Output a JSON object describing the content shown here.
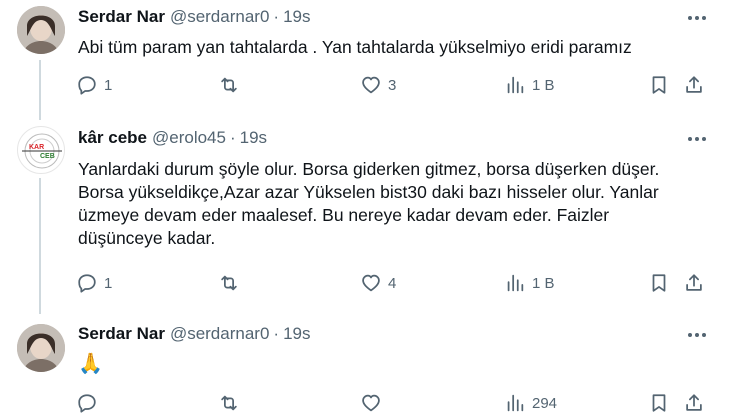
{
  "tweets": [
    {
      "author": "Serdar Nar",
      "handle": "@serdarnar0",
      "dot": "·",
      "time": "19s",
      "text": "Abi tüm param yan tahtalarda . Yan tahtalarda yükselmiyo eridi paramız",
      "replies": "1",
      "retweets": "",
      "likes": "3",
      "views": "1 B",
      "avatar_icon": "person-photo"
    },
    {
      "author": "kâr cebe",
      "handle": "@erolo45",
      "dot": "·",
      "time": "19s",
      "text_lines": [
        "Yanlardaki durum şöyle olur. Borsa giderken gitmez, borsa düşerken düşer.",
        "Borsa yükseldikçe,Azar azar Yükselen bist30 daki bazı hisseler olur. Yanlar",
        "üzmeye devam eder maalesef. Bu nereye kadar devam eder. Faizler",
        "düşünceye kadar."
      ],
      "replies": "1",
      "retweets": "",
      "likes": "4",
      "views": "1 B",
      "avatar_icon": "logo",
      "logo_text_top": "KAR",
      "logo_text_bottom": "CEB"
    },
    {
      "author": "Serdar Nar",
      "handle": "@serdarnar0",
      "dot": "·",
      "time": "19s",
      "text": "🙏",
      "replies": "",
      "retweets": "",
      "likes": "",
      "views": "294",
      "avatar_icon": "person-photo"
    }
  ],
  "colors": {
    "text": "#0f1419",
    "secondary": "#536471",
    "thread_line": "#cfd9de",
    "logo_red": "#d9252a",
    "logo_green": "#2e7d32"
  },
  "icons": [
    "reply-icon",
    "retweet-icon",
    "like-icon",
    "views-icon",
    "bookmark-icon",
    "share-icon",
    "more-icon"
  ]
}
